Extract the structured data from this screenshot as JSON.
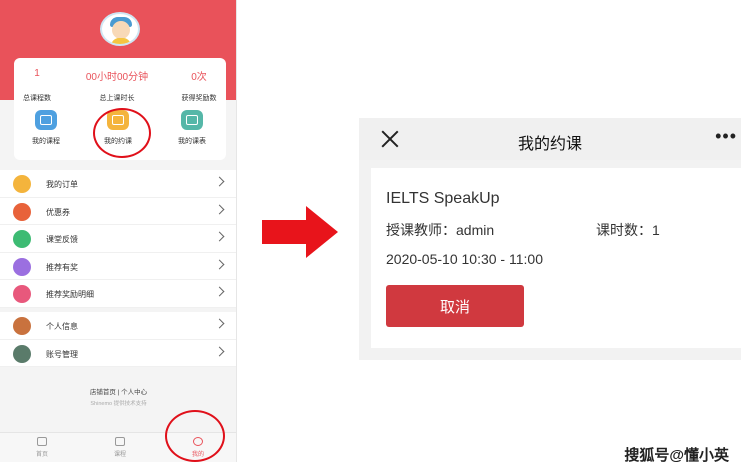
{
  "left_phone": {
    "stats": [
      {
        "value": "1",
        "label": "总课程数"
      },
      {
        "value": "00小时00分钟",
        "label": "总上课时长"
      },
      {
        "value": "0次",
        "label": "获得奖励数"
      }
    ],
    "quick_actions": [
      {
        "label": "我的课程",
        "icon": "book-icon",
        "color": "#4ea0e0"
      },
      {
        "label": "我的约课",
        "icon": "appointment-icon",
        "color": "#f4b43c"
      },
      {
        "label": "我的课表",
        "icon": "timetable-icon",
        "color": "#55b7a8"
      }
    ],
    "menu_group1": [
      {
        "label": "我的订单",
        "icon": "yen-icon",
        "color": "#f4b43c"
      },
      {
        "label": "优惠券",
        "icon": "coupon-icon",
        "color": "#e8623a"
      },
      {
        "label": "课堂反馈",
        "icon": "feedback-icon",
        "color": "#3dbb73"
      },
      {
        "label": "推荐有奖",
        "icon": "gift-icon",
        "color": "#9b6fe0"
      },
      {
        "label": "推荐奖励明细",
        "icon": "reward-detail-icon",
        "color": "#e8587c"
      }
    ],
    "menu_group2": [
      {
        "label": "个人信息",
        "icon": "person-icon",
        "color": "#c9723e"
      },
      {
        "label": "账号管理",
        "icon": "gear-icon",
        "color": "#5a7b6a"
      }
    ],
    "footer_links": "店铺首页  |  个人中心",
    "powered_by": "Shinemo 提供技术支持",
    "tabs": [
      {
        "label": "首页",
        "icon": "home-icon"
      },
      {
        "label": "课程",
        "icon": "course-icon"
      },
      {
        "label": "我的",
        "icon": "mine-icon"
      }
    ]
  },
  "right_panel": {
    "title": "我的约课",
    "more": "•••",
    "course_name": "IELTS SpeakUp",
    "teacher": "授课教师：admin",
    "hours": "课时数：1",
    "time": "2020-05-10 10:30 - 11:00",
    "cancel_label": "取消"
  },
  "watermark": "搜狐号@懂小英",
  "colors": {
    "brand_red": "#e9525a",
    "button_red": "#d0393f",
    "arrow_red": "#e8141b"
  }
}
